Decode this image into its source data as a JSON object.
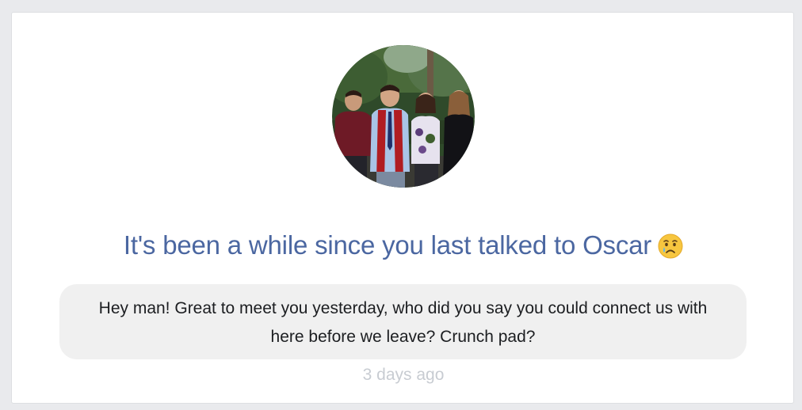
{
  "reminder": {
    "headline": "It's been a while since you last talked to Oscar",
    "emoji_icon": "crying-face-icon",
    "last_message": "Hey man! Great to meet you yesterday, who did you say you could connect us with here before we leave? Crunch pad?",
    "timestamp": "3 days ago",
    "colors": {
      "headline": "#4b67a1",
      "bubble_bg": "#f0f0f0",
      "timestamp": "#c8ccd2",
      "page_bg": "#e9eaed"
    }
  }
}
